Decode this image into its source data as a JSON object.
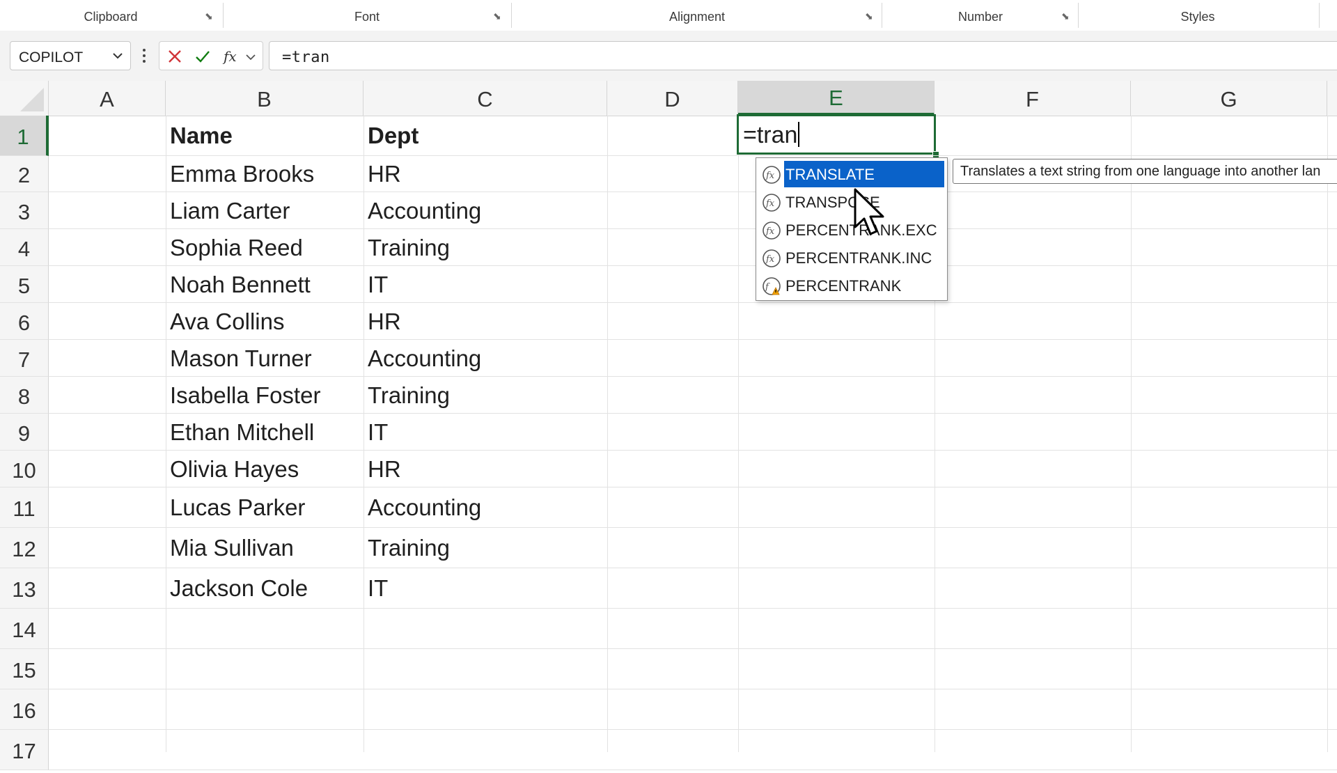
{
  "ribbon": {
    "groups": [
      {
        "label": "Clipboard"
      },
      {
        "label": "Font"
      },
      {
        "label": "Alignment"
      },
      {
        "label": "Number"
      },
      {
        "label": "Styles"
      }
    ]
  },
  "formula_bar": {
    "name_box": "COPILOT",
    "formula": "=tran"
  },
  "grid": {
    "columns": [
      "A",
      "B",
      "C",
      "D",
      "E",
      "F",
      "G"
    ],
    "active_column": "E",
    "rows": [
      "1",
      "2",
      "3",
      "4",
      "5",
      "6",
      "7",
      "8",
      "9",
      "10",
      "11",
      "12",
      "13",
      "14",
      "15",
      "16",
      "17"
    ],
    "active_row": "1",
    "header": {
      "name": "Name",
      "dept": "Dept"
    },
    "data": [
      {
        "name": "Emma Brooks",
        "dept": "HR"
      },
      {
        "name": "Liam Carter",
        "dept": "Accounting"
      },
      {
        "name": "Sophia Reed",
        "dept": "Training"
      },
      {
        "name": "Noah Bennett",
        "dept": "IT"
      },
      {
        "name": "Ava Collins",
        "dept": "HR"
      },
      {
        "name": "Mason Turner",
        "dept": "Accounting"
      },
      {
        "name": "Isabella Foster",
        "dept": "Training"
      },
      {
        "name": "Ethan Mitchell",
        "dept": "IT"
      },
      {
        "name": "Olivia Hayes",
        "dept": "HR"
      },
      {
        "name": "Lucas Parker",
        "dept": "Accounting"
      },
      {
        "name": "Mia Sullivan",
        "dept": "Training"
      },
      {
        "name": "Jackson Cole",
        "dept": "IT"
      }
    ],
    "editing_cell_text": "=tran"
  },
  "autocomplete": {
    "items": [
      {
        "label": "TRANSLATE",
        "icon": "function-icon",
        "selected": true
      },
      {
        "label": "TRANSPOSE",
        "icon": "function-icon",
        "selected": false
      },
      {
        "label": "PERCENTRANK.EXC",
        "icon": "function-icon",
        "selected": false
      },
      {
        "label": "PERCENTRANK.INC",
        "icon": "function-icon",
        "selected": false
      },
      {
        "label": "PERCENTRANK",
        "icon": "compatibility-function-icon",
        "selected": false
      }
    ],
    "tooltip": "Translates a text string from one language into another lan"
  },
  "colors": {
    "accent_green": "#1e6b35",
    "selection_blue": "#0a62c9",
    "cancel_red": "#d13438",
    "enter_green": "#107c10"
  }
}
